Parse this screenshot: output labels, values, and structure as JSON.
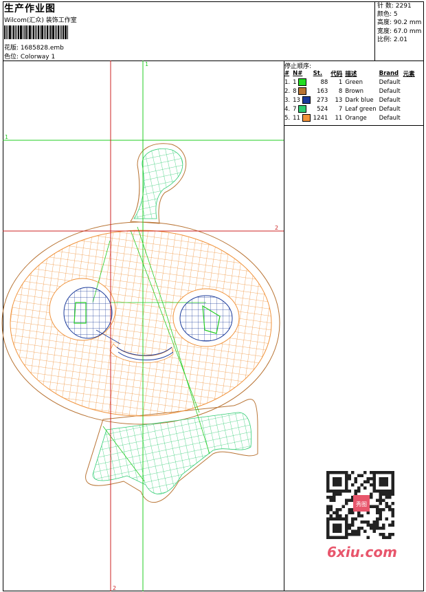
{
  "header": {
    "title": "生产作业图",
    "company": "Wilcom(汇众) 装饰工作室",
    "design_label": "花版:",
    "design_value": "1685828.emb",
    "colorway_label": "色位:",
    "colorway_value": "Colorway 1"
  },
  "specs": [
    {
      "label": "针 数:",
      "value": "2291"
    },
    {
      "label": "颜色:",
      "value": "5"
    },
    {
      "label": "高度:",
      "value": "90.2 mm"
    },
    {
      "label": "宽度:",
      "value": "67.0 mm"
    },
    {
      "label": "比例:",
      "value": "2.01"
    }
  ],
  "stop_sequence": {
    "title": "停止顺序:",
    "headers": {
      "num": "#",
      "n": "N#",
      "st": "St.",
      "code": "代码",
      "desc": "描述",
      "brand": "Brand",
      "element": "元素"
    },
    "rows": [
      {
        "num": "1.",
        "n": "1",
        "color": "#22dd22",
        "st": "88",
        "code": "1",
        "desc": "Green",
        "brand": "Default"
      },
      {
        "num": "2.",
        "n": "8",
        "color": "#b87333",
        "st": "163",
        "code": "8",
        "desc": "Brown",
        "brand": "Default"
      },
      {
        "num": "3.",
        "n": "13",
        "color": "#1a3a9a",
        "st": "273",
        "code": "13",
        "desc": "Dark blue",
        "brand": "Default"
      },
      {
        "num": "4.",
        "n": "7",
        "color": "#2ecc71",
        "st": "524",
        "code": "7",
        "desc": "Leaf green",
        "brand": "Default"
      },
      {
        "num": "5.",
        "n": "11",
        "color": "#f0923a",
        "st": "1241",
        "code": "11",
        "desc": "Orange",
        "brand": "Default"
      }
    ]
  },
  "guides": {
    "green_v": "1",
    "green_h": "1",
    "red_h": "2",
    "red_v": "2"
  },
  "colors": {
    "green": "#22cc22",
    "red": "#cc2222",
    "orange": "#f0923a",
    "brown": "#b87333",
    "dark_blue": "#1a3a9a",
    "leaf_green": "#2ecc71"
  },
  "watermark": {
    "text": "6xiu.com",
    "qr_badge": "秀图"
  }
}
